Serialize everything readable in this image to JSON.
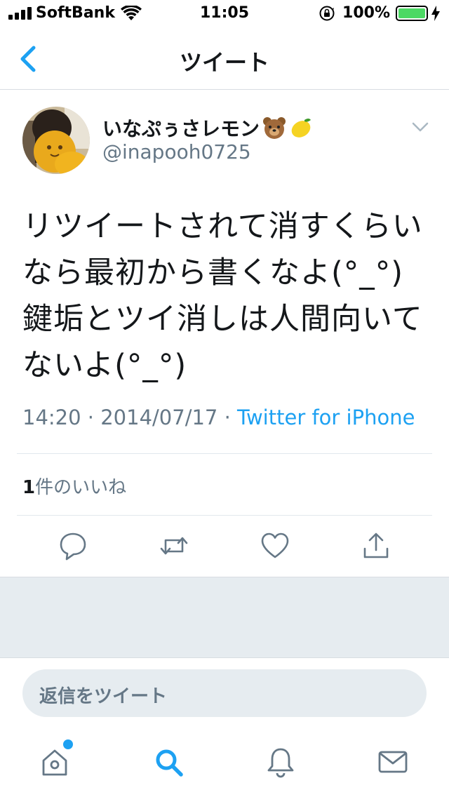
{
  "status_bar": {
    "carrier": "SoftBank",
    "time": "11:05",
    "battery_percent": "100%",
    "battery_level": 1.0,
    "battery_color": "#4cd964"
  },
  "nav": {
    "title": "ツイート",
    "back_icon": "chevron-left-icon"
  },
  "tweet": {
    "display_name": "いなぷぅさレモン",
    "name_emojis": [
      "bear-face-icon",
      "lemon-icon"
    ],
    "handle": "@inapooh0725",
    "text_lines": [
      "リツイートされて消すくらい",
      "なら最初から書くなよ(°_°)",
      "鍵垢とツイ消しは人間向いて",
      "ないよ(°_°)"
    ],
    "time": "14:20",
    "date": "2014/07/17",
    "separator": "·",
    "source": "Twitter for iPhone",
    "likes_count": "1",
    "likes_label": "件のいいね"
  },
  "actions": [
    "reply-icon",
    "retweet-icon",
    "like-heart-icon",
    "share-icon"
  ],
  "reply": {
    "placeholder": "返信をツイート"
  },
  "tabs": [
    "home-icon",
    "search-icon",
    "notifications-bell-icon",
    "messages-envelope-icon"
  ],
  "colors": {
    "accent": "#1da1f2",
    "secondary_text": "#657786",
    "background_gray": "#e6ecf0"
  }
}
